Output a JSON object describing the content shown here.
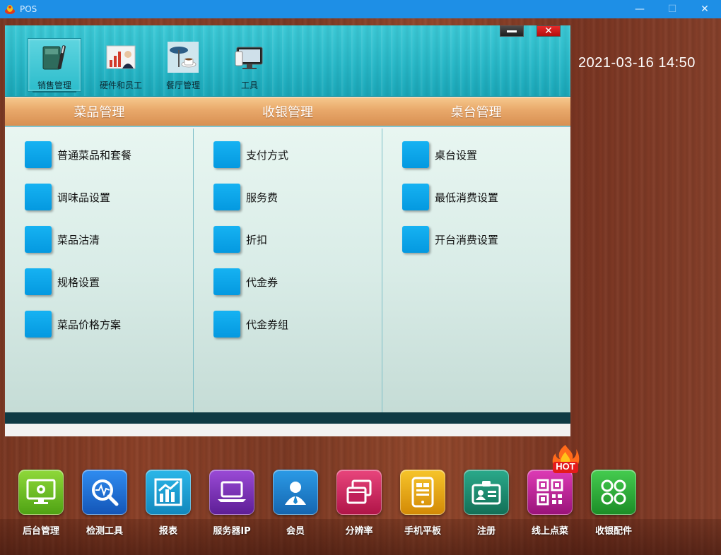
{
  "window": {
    "title": "POS",
    "minimize": "—",
    "maximize": "☐",
    "close": "✕"
  },
  "clock": "2021-03-16 14:50",
  "panel": {
    "close_glyph": "✕",
    "tabs": [
      {
        "label": "销售管理",
        "icon": "ledger-pen-icon",
        "active": true
      },
      {
        "label": "硬件和员工",
        "icon": "staff-chart-icon",
        "active": false
      },
      {
        "label": "餐厅管理",
        "icon": "coffee-table-icon",
        "active": false
      },
      {
        "label": "工具",
        "icon": "devices-icon",
        "active": false
      }
    ],
    "sections": [
      {
        "title": "菜品管理",
        "items": [
          "普通菜品和套餐",
          "调味品设置",
          "菜品沽清",
          "规格设置",
          "菜品价格方案"
        ]
      },
      {
        "title": "收银管理",
        "items": [
          "支付方式",
          "服务费",
          "折扣",
          "代金券",
          "代金券组"
        ]
      },
      {
        "title": "桌台管理",
        "items": [
          "桌台设置",
          "最低消费设置",
          "开台消费设置"
        ]
      }
    ]
  },
  "dock": [
    {
      "label": "后台管理",
      "icon": "monitor-gear-icon",
      "color": "#6fbf1f"
    },
    {
      "label": "检测工具",
      "icon": "magnifier-pulse-icon",
      "color": "#1d6fd6"
    },
    {
      "label": "报表",
      "icon": "bar-chart-icon",
      "color": "#1c9fd3"
    },
    {
      "label": "服务器IP",
      "icon": "laptop-icon",
      "color": "#7a2fb8"
    },
    {
      "label": "会员",
      "icon": "person-icon",
      "color": "#1a87d0"
    },
    {
      "label": "分辨率",
      "icon": "windows-icon",
      "color": "#d12a63"
    },
    {
      "label": "手机平板",
      "icon": "tablet-icon",
      "color": "#e8a812"
    },
    {
      "label": "注册",
      "icon": "id-card-icon",
      "color": "#1e8a73"
    },
    {
      "label": "线上点菜",
      "icon": "qr-code-icon",
      "color": "#c21f9a"
    },
    {
      "label": "收银配件",
      "icon": "clover-icon",
      "color": "#2cb23a"
    }
  ],
  "hot_badge": "HOT"
}
